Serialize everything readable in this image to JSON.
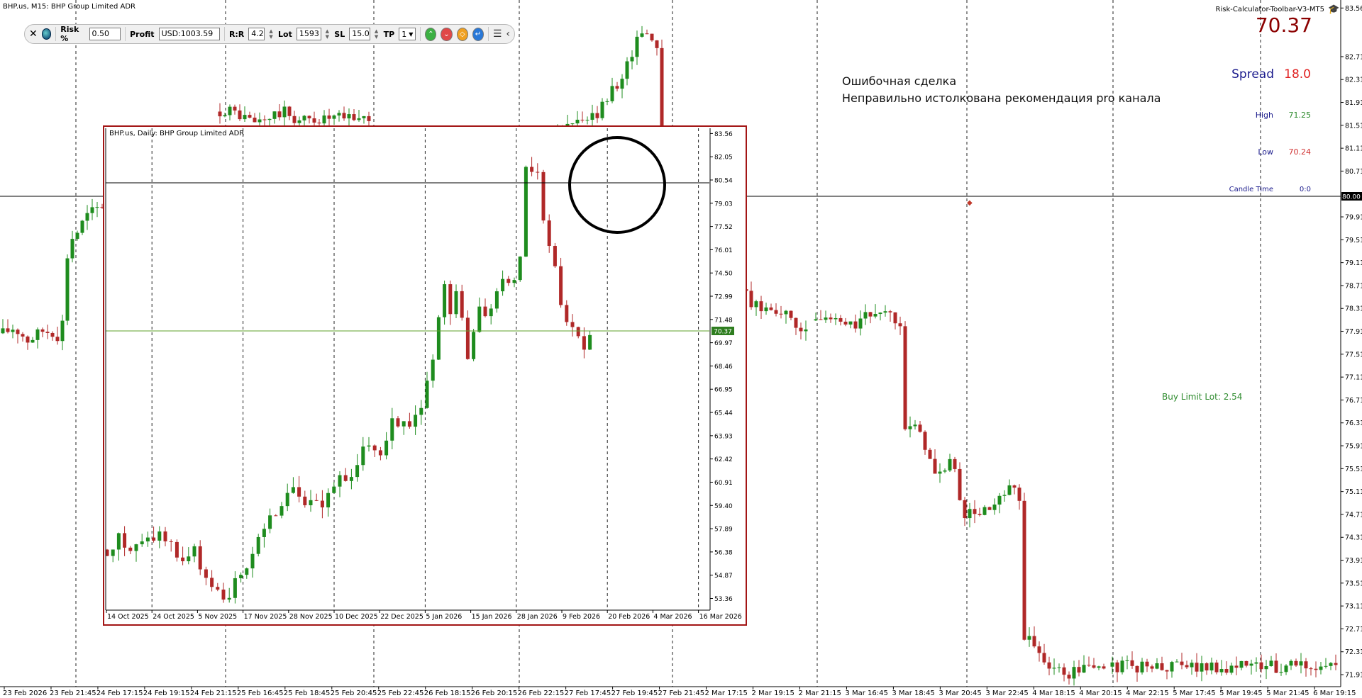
{
  "main_chart": {
    "title": "BHP.us, M15:  BHP Group Limited ADR",
    "price_labels": [
      "83.56",
      "82.71",
      "82.31",
      "81.91",
      "81.51",
      "81.11",
      "80.71",
      "79.91",
      "79.51",
      "79.11",
      "78.71",
      "78.31",
      "77.91",
      "77.51",
      "77.11",
      "76.71",
      "76.31",
      "75.91",
      "75.51",
      "75.11",
      "74.71",
      "74.31",
      "73.91",
      "73.51",
      "73.11",
      "72.71",
      "72.31",
      "71.91"
    ],
    "current_marker": "80.00",
    "x_labels": [
      "23 Feb 2026",
      "23 Feb 21:45",
      "24 Feb 17:15",
      "24 Feb 19:15",
      "24 Feb 21:15",
      "25 Feb 16:45",
      "25 Feb 18:45",
      "25 Feb 20:45",
      "25 Feb 22:45",
      "26 Feb 18:15",
      "26 Feb 20:15",
      "26 Feb 22:15",
      "27 Feb 17:45",
      "27 Feb 19:45",
      "27 Feb 21:45",
      "2 Mar 17:15",
      "2 Mar 19:15",
      "2 Mar 21:15",
      "3 Mar 16:45",
      "3 Mar 18:45",
      "3 Mar 20:45",
      "3 Mar 22:45",
      "4 Mar 18:15",
      "4 Mar 20:15",
      "4 Mar 22:15",
      "5 Mar 17:45",
      "5 Mar 19:45",
      "5 Mar 21:45",
      "6 Mar 19:15"
    ]
  },
  "inset_chart": {
    "title": "BHP.us, Daily:  BHP Group Limited ADR",
    "price_labels": [
      "83.56",
      "82.05",
      "80.54",
      "79.03",
      "77.52",
      "76.01",
      "74.50",
      "72.99",
      "71.48",
      "69.97",
      "68.46",
      "66.95",
      "65.44",
      "63.93",
      "62.42",
      "60.91",
      "59.40",
      "57.89",
      "56.38",
      "54.87",
      "53.36"
    ],
    "current_price": "70.37",
    "x_labels": [
      "14 Oct 2025",
      "24 Oct 2025",
      "5 Nov 2025",
      "17 Nov 2025",
      "28 Nov 2025",
      "10 Dec 2025",
      "22 Dec 2025",
      "5 Jan 2026",
      "15 Jan 2026",
      "28 Jan 2026",
      "9 Feb 2026",
      "20 Feb 2026",
      "4 Mar 2026",
      "16 Mar 2026"
    ]
  },
  "chart_data": [
    {
      "type": "candlestick",
      "title": "BHP.us, M15:  BHP Group Limited ADR",
      "ylim": [
        71.7,
        83.7
      ],
      "y_ticks": [
        83.56,
        82.71,
        82.31,
        81.91,
        81.51,
        81.11,
        80.71,
        79.91,
        79.51,
        79.11,
        78.71,
        78.31,
        77.91,
        77.51,
        77.11,
        76.71,
        76.31,
        75.91,
        75.51,
        75.11,
        74.71,
        74.31,
        73.91,
        73.51,
        73.11,
        72.71,
        72.31,
        71.91
      ],
      "x_ticks": [
        "23 Feb 2026",
        "23 Feb 21:45",
        "24 Feb 17:15",
        "24 Feb 19:15",
        "24 Feb 21:15",
        "25 Feb 16:45",
        "25 Feb 18:45",
        "25 Feb 20:45",
        "25 Feb 22:45",
        "26 Feb 18:15",
        "26 Feb 20:15",
        "26 Feb 22:15",
        "27 Feb 17:45",
        "27 Feb 19:45",
        "27 Feb 21:45",
        "2 Mar 17:15",
        "2 Mar 19:15",
        "2 Mar 21:15",
        "3 Mar 16:45",
        "3 Mar 18:45",
        "3 Mar 20:45",
        "3 Mar 22:45",
        "4 Mar 18:15",
        "4 Mar 20:15",
        "4 Mar 22:15",
        "5 Mar 17:45",
        "5 Mar 19:45",
        "5 Mar 21:45",
        "6 Mar 19:15"
      ],
      "current_price": 80.0,
      "bull_color": "#1e8c1e",
      "bear_color": "#b02828",
      "grid": "vertical-dashed",
      "path": [
        [
          0,
          77.85
        ],
        [
          20,
          77.98
        ],
        [
          40,
          77.75
        ],
        [
          60,
          77.92
        ],
        [
          80,
          77.9
        ],
        [
          86,
          77.55
        ],
        [
          92,
          79.1
        ],
        [
          102,
          79.55
        ],
        [
          112,
          79.7
        ],
        [
          120,
          79.9
        ],
        [
          256,
          81.2
        ],
        [
          280,
          81.6
        ],
        [
          320,
          81.8
        ],
        [
          360,
          81.55
        ],
        [
          400,
          81.75
        ],
        [
          418,
          81.6
        ],
        [
          596,
          81.7
        ],
        [
          620,
          81.4
        ],
        [
          640,
          81.5
        ],
        [
          670,
          81.1
        ],
        [
          720,
          81.0
        ],
        [
          760,
          81.25
        ],
        [
          800,
          81.5
        ],
        [
          840,
          81.65
        ],
        [
          880,
          82.45
        ],
        [
          905,
          83.2
        ],
        [
          928,
          82.9
        ],
        [
          936,
          77.9
        ],
        [
          960,
          76.8
        ],
        [
          980,
          78.1
        ],
        [
          1000,
          78.3
        ],
        [
          1040,
          78.75
        ],
        [
          1060,
          78.35
        ],
        [
          1100,
          78.3
        ],
        [
          1120,
          77.95
        ],
        [
          1160,
          78.15
        ],
        [
          1200,
          78.0
        ],
        [
          1240,
          78.3
        ],
        [
          1270,
          78.1
        ],
        [
          1276,
          76.3
        ],
        [
          1300,
          76.1
        ],
        [
          1320,
          75.3
        ],
        [
          1340,
          75.7
        ],
        [
          1360,
          74.7
        ],
        [
          1400,
          74.8
        ],
        [
          1420,
          75.1
        ],
        [
          1436,
          75.2
        ],
        [
          1444,
          72.6
        ],
        [
          1470,
          72.2
        ],
        [
          1500,
          71.9
        ],
        [
          1530,
          72.05
        ]
      ]
    },
    {
      "type": "candlestick",
      "title": "BHP.us, Daily:  BHP Group Limited ADR",
      "ylim": [
        52.6,
        83.9
      ],
      "y_ticks": [
        83.56,
        82.05,
        80.54,
        79.03,
        77.52,
        76.01,
        74.5,
        72.99,
        71.48,
        69.97,
        68.46,
        66.95,
        65.44,
        63.93,
        62.42,
        60.91,
        59.4,
        57.89,
        56.38,
        54.87,
        53.36
      ],
      "x_ticks": [
        "14 Oct 2025",
        "24 Oct 2025",
        "5 Nov 2025",
        "17 Nov 2025",
        "28 Nov 2025",
        "10 Dec 2025",
        "22 Dec 2025",
        "5 Jan 2026",
        "15 Jan 2026",
        "28 Jan 2026",
        "9 Feb 2026",
        "20 Feb 2026",
        "4 Mar 2026",
        "16 Mar 2026"
      ],
      "current_price": 70.37,
      "path": [
        [
          0,
          56.2
        ],
        [
          20,
          57.3
        ],
        [
          40,
          56.5
        ],
        [
          60,
          57.0
        ],
        [
          80,
          57.6
        ],
        [
          95,
          56.9
        ],
        [
          110,
          55.8
        ],
        [
          130,
          56.4
        ],
        [
          150,
          54.0
        ],
        [
          170,
          53.2
        ],
        [
          190,
          54.5
        ],
        [
          210,
          56.2
        ],
        [
          230,
          58.4
        ],
        [
          250,
          59.2
        ],
        [
          270,
          60.6
        ],
        [
          290,
          59.3
        ],
        [
          310,
          59.6
        ],
        [
          330,
          61.2
        ],
        [
          350,
          60.8
        ],
        [
          370,
          63.9
        ],
        [
          390,
          62.9
        ],
        [
          410,
          65.3
        ],
        [
          430,
          64.2
        ],
        [
          450,
          66.3
        ],
        [
          470,
          69.5
        ],
        [
          478,
          74.3
        ],
        [
          490,
          71.5
        ],
        [
          500,
          73.3
        ],
        [
          515,
          69.0
        ],
        [
          530,
          72.8
        ],
        [
          545,
          71.6
        ],
        [
          560,
          74.1
        ],
        [
          575,
          73.5
        ],
        [
          590,
          76.1
        ],
        [
          582,
          79.2
        ],
        [
          590,
          80.5
        ],
        [
          600,
          81.9
        ],
        [
          610,
          80.5
        ],
        [
          615,
          82.2
        ],
        [
          622,
          77.5
        ],
        [
          635,
          75.8
        ],
        [
          645,
          72.8
        ],
        [
          655,
          71.6
        ],
        [
          668,
          70.7
        ],
        [
          675,
          69.5
        ],
        [
          685,
          70.6
        ]
      ]
    }
  ],
  "toolbar": {
    "risk_label": "Risk %",
    "risk_value": "0.50",
    "profit_label": "Profit",
    "profit_value": "USD:1003.59",
    "rr_label": "R:R",
    "rr_value": "4.2",
    "lot_label": "Lot",
    "lot_value": "1593",
    "sl_label": "SL",
    "sl_value": "15.0",
    "tp_label": "TP",
    "tp_value": "1"
  },
  "info_panel": {
    "title": "Risk-Calculator-Toolbar-V3-MT5",
    "price": "70.37",
    "spread_label": "Spread",
    "spread_value": "18.0",
    "high_label": "High",
    "high_value": "71.25",
    "low_label": "Low",
    "low_value": "70.24",
    "candle_time_label": "Candle Time",
    "candle_time_value": "0:0"
  },
  "annotation": {
    "line1": "Ошибочная сделка",
    "line2": "Неправильно истолкована рекомендация pro канала"
  },
  "buy_limit_label": "Buy Limit Lot: 2.54",
  "colors": {
    "bull": "#1e8c1e",
    "bear": "#b02828",
    "price_line": "#5ea02a",
    "inset_frame": "#a31515",
    "spread_label": "#1a1a8c",
    "spread_value": "#e02020",
    "high_value": "#2e8b2e",
    "low_value": "#d03030",
    "price_text": "#8b0000"
  }
}
